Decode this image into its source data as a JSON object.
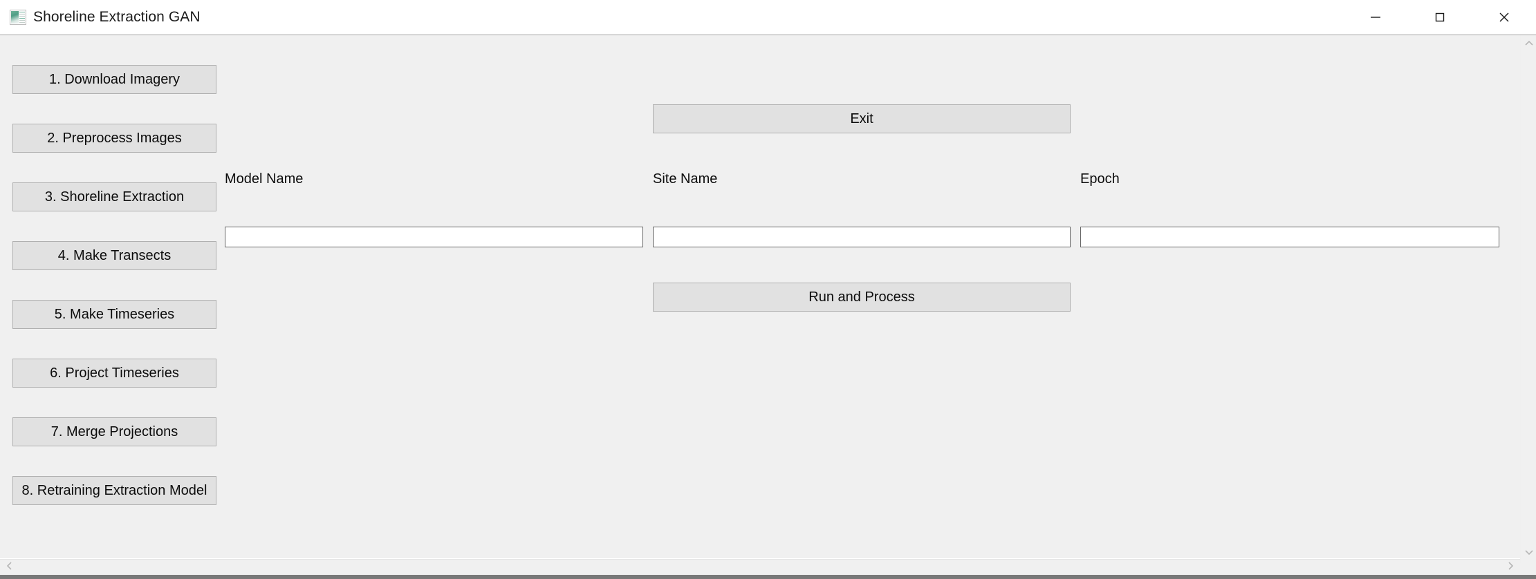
{
  "window": {
    "title": "Shoreline Extraction GAN",
    "icon": "app-thumbnail-icon",
    "controls": {
      "minimize": "minimize-icon",
      "maximize": "maximize-icon",
      "close": "close-icon"
    },
    "colors": {
      "titlebar_bg": "#ffffff",
      "content_bg": "#f0f0f0",
      "button_bg": "#e1e1e1",
      "button_border": "#b0b0b0",
      "field_bg": "#ffffff",
      "field_border": "#666666",
      "text": "#0c0c0c"
    }
  },
  "sidebar": {
    "steps": [
      {
        "label": "1. Download Imagery"
      },
      {
        "label": "2. Preprocess Images"
      },
      {
        "label": "3. Shoreline Extraction"
      },
      {
        "label": "4. Make Transects"
      },
      {
        "label": "5. Make Timeseries"
      },
      {
        "label": "6. Project Timeseries"
      },
      {
        "label": "7. Merge Projections"
      },
      {
        "label": "8. Retraining Extraction Model"
      }
    ]
  },
  "main": {
    "exit_button": "Exit",
    "run_button": "Run and Process",
    "fields": [
      {
        "label": "Model Name",
        "value": "",
        "placeholder": ""
      },
      {
        "label": "Site Name",
        "value": "",
        "placeholder": ""
      },
      {
        "label": "Epoch",
        "value": "",
        "placeholder": ""
      }
    ]
  },
  "scrollbars": {
    "vertical": {
      "up": "chevron-up-icon",
      "down": "chevron-down-icon"
    },
    "horizontal": {
      "left": "chevron-left-icon",
      "right": "chevron-right-icon"
    }
  }
}
